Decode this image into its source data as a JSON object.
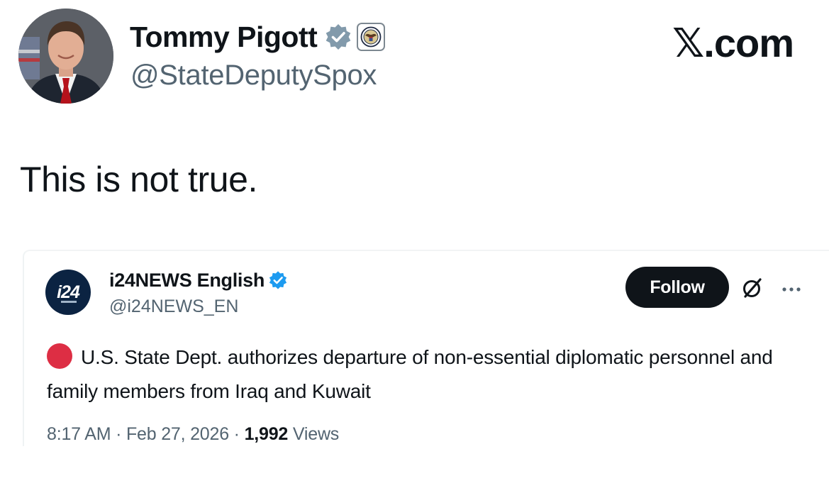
{
  "post": {
    "author_name": "Tommy Pigott",
    "author_handle": "@StateDeputySpox",
    "brand": "𝕏.com",
    "text": "This is not true."
  },
  "quoted_post": {
    "avatar_text": "i24",
    "author_name": "i24NEWS English",
    "author_handle": "@i24NEWS_EN",
    "follow_label": "Follow",
    "text": "U.S. State Dept. authorizes departure of non-essential diplomatic personnel and family members from Iraq and Kuwait",
    "time": "8:17 AM",
    "separator": "·",
    "date": "Feb 27, 2026",
    "views_count": "1,992",
    "views_label": "Views"
  },
  "icons": {
    "verified": "verified-badge-icon",
    "affiliation": "state-department-seal-icon",
    "grok": "grok-icon",
    "more": "more-icon",
    "status_dot": "red-circle-emoji-icon"
  },
  "colors": {
    "text_primary": "#0f1419",
    "text_secondary": "#536471",
    "verified_gray": "#829aab",
    "verified_blue": "#1d9bf0",
    "status_red": "#dd2e44",
    "button_dark": "#0f1419"
  }
}
